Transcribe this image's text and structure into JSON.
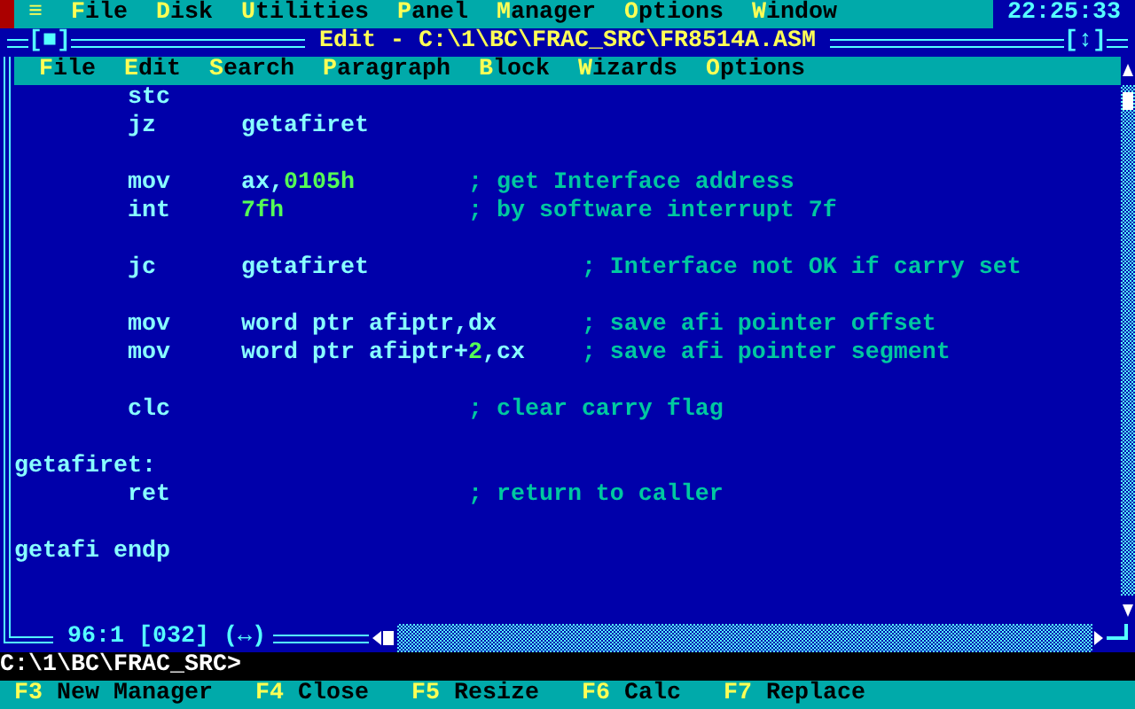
{
  "top_menu": {
    "icon": "≡",
    "items": [
      {
        "hotkey": "F",
        "rest": "ile"
      },
      {
        "hotkey": "D",
        "rest": "isk"
      },
      {
        "hotkey": "U",
        "rest": "tilities"
      },
      {
        "hotkey": "P",
        "rest": "anel"
      },
      {
        "hotkey": "M",
        "rest": "anager"
      },
      {
        "hotkey": "O",
        "rest": "ptions"
      },
      {
        "hotkey": "W",
        "rest": "indow"
      }
    ]
  },
  "clock": "22:25:33",
  "editor": {
    "close_box": "[■]",
    "title": "Edit - C:\\1\\BC\\FRAC_SRC\\FR8514A.ASM",
    "zoom_box": "[↕]",
    "menu": [
      {
        "hotkey": "F",
        "rest": "ile"
      },
      {
        "hotkey": "E",
        "rest": "dit"
      },
      {
        "hotkey": "S",
        "rest": "earch"
      },
      {
        "hotkey": "P",
        "rest": "aragraph"
      },
      {
        "hotkey": "B",
        "rest": "lock"
      },
      {
        "hotkey": "W",
        "rest": "izards"
      },
      {
        "hotkey": "O",
        "rest": "ptions"
      }
    ],
    "lines": [
      {
        "kind": "code",
        "tokens": [
          {
            "kind": "tab"
          },
          {
            "kind": "instruction",
            "text": "stc"
          }
        ]
      },
      {
        "kind": "code",
        "tokens": [
          {
            "kind": "tab"
          },
          {
            "kind": "instruction",
            "text": "jz"
          },
          {
            "kind": "tab"
          },
          {
            "kind": "operand",
            "parts": [
              {
                "kind": "text",
                "text": "getafiret"
              }
            ]
          }
        ]
      },
      {
        "kind": "blank"
      },
      {
        "kind": "code",
        "tokens": [
          {
            "kind": "tab"
          },
          {
            "kind": "instruction",
            "text": "mov"
          },
          {
            "kind": "tab"
          },
          {
            "kind": "operand",
            "parts": [
              {
                "kind": "text",
                "text": "ax,"
              },
              {
                "kind": "number",
                "text": "0105h"
              }
            ]
          },
          {
            "kind": "tab"
          },
          {
            "kind": "comment",
            "text": "; get Interface address"
          }
        ]
      },
      {
        "kind": "code",
        "tokens": [
          {
            "kind": "tab"
          },
          {
            "kind": "instruction",
            "text": "int"
          },
          {
            "kind": "tab"
          },
          {
            "kind": "operand",
            "parts": [
              {
                "kind": "number",
                "text": "7fh"
              }
            ]
          },
          {
            "kind": "tab"
          },
          {
            "kind": "tab"
          },
          {
            "kind": "comment",
            "text": "; by software interrupt 7f"
          }
        ]
      },
      {
        "kind": "blank"
      },
      {
        "kind": "code",
        "tokens": [
          {
            "kind": "tab"
          },
          {
            "kind": "instruction",
            "text": "jc"
          },
          {
            "kind": "tab"
          },
          {
            "kind": "operand",
            "parts": [
              {
                "kind": "text",
                "text": "getafiret"
              }
            ]
          },
          {
            "kind": "tab"
          },
          {
            "kind": "tab"
          },
          {
            "kind": "comment",
            "text": "; Interface not OK if carry set"
          }
        ]
      },
      {
        "kind": "blank"
      },
      {
        "kind": "code",
        "tokens": [
          {
            "kind": "tab"
          },
          {
            "kind": "instruction",
            "text": "mov"
          },
          {
            "kind": "tab"
          },
          {
            "kind": "operand",
            "parts": [
              {
                "kind": "text",
                "text": "word ptr afiptr,dx"
              }
            ]
          },
          {
            "kind": "tab"
          },
          {
            "kind": "comment",
            "text": "; save afi pointer offset"
          }
        ]
      },
      {
        "kind": "code",
        "tokens": [
          {
            "kind": "tab"
          },
          {
            "kind": "instruction",
            "text": "mov"
          },
          {
            "kind": "tab"
          },
          {
            "kind": "operand",
            "parts": [
              {
                "kind": "text",
                "text": "word ptr afiptr+"
              },
              {
                "kind": "number",
                "text": "2"
              },
              {
                "kind": "text",
                "text": ",cx"
              }
            ]
          },
          {
            "kind": "tab"
          },
          {
            "kind": "comment",
            "text": "; save afi pointer segment"
          }
        ]
      },
      {
        "kind": "blank"
      },
      {
        "kind": "code",
        "tokens": [
          {
            "kind": "tab"
          },
          {
            "kind": "instruction",
            "text": "clc"
          },
          {
            "kind": "tab"
          },
          {
            "kind": "tab"
          },
          {
            "kind": "tab"
          },
          {
            "kind": "comment",
            "text": "; clear carry flag"
          }
        ]
      },
      {
        "kind": "blank"
      },
      {
        "kind": "code",
        "tokens": [
          {
            "kind": "label",
            "text": "getafiret:"
          }
        ]
      },
      {
        "kind": "code",
        "tokens": [
          {
            "kind": "tab"
          },
          {
            "kind": "instruction",
            "text": "ret"
          },
          {
            "kind": "tab"
          },
          {
            "kind": "tab"
          },
          {
            "kind": "tab"
          },
          {
            "kind": "comment",
            "text": "; return to caller"
          }
        ]
      },
      {
        "kind": "blank"
      },
      {
        "kind": "code",
        "tokens": [
          {
            "kind": "label",
            "text": "getafi endp"
          }
        ]
      },
      {
        "kind": "blank"
      },
      {
        "kind": "blank"
      }
    ],
    "status": "96:1 [032] (↔)"
  },
  "command_line": "C:\\1\\BC\\FRAC_SRC>",
  "function_keys": [
    {
      "key": "F3",
      "label": "New Manager"
    },
    {
      "key": "F4",
      "label": "Close"
    },
    {
      "key": "F5",
      "label": "Resize"
    },
    {
      "key": "F6",
      "label": "Calc"
    },
    {
      "key": "F7",
      "label": "Replace"
    }
  ]
}
